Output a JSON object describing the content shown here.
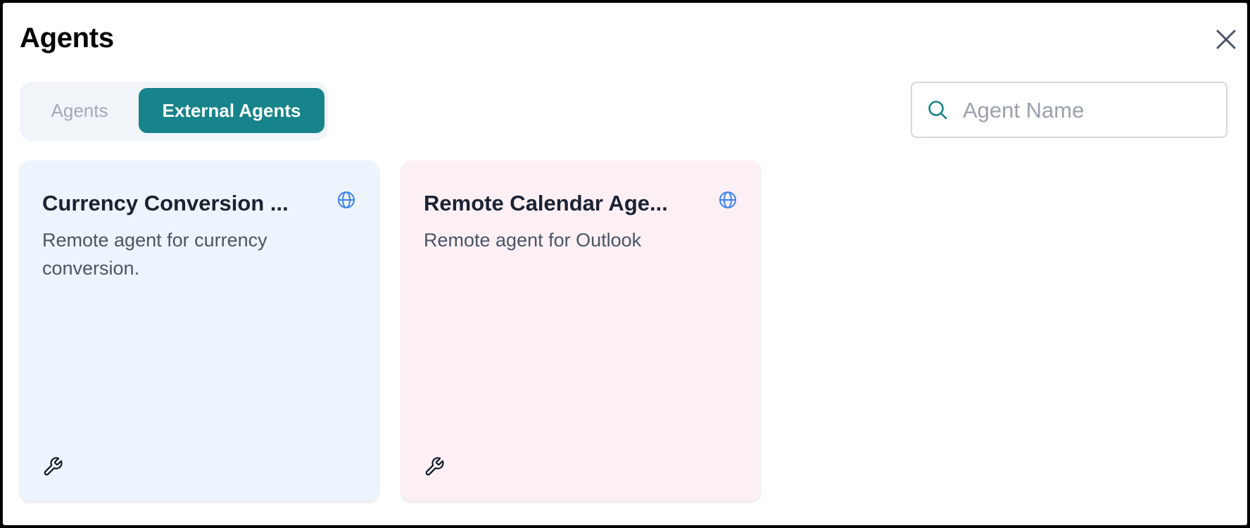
{
  "dialog": {
    "title": "Agents",
    "close_icon": "close-icon"
  },
  "tabs": [
    {
      "label": "Agents",
      "active": false
    },
    {
      "label": "External Agents",
      "active": true
    }
  ],
  "search": {
    "placeholder": "Agent Name",
    "value": "",
    "icon": "search-icon"
  },
  "cards": [
    {
      "title": "Currency Conversion ...",
      "description": "Remote agent for currency conversion.",
      "badge_icon": "globe-icon",
      "tool_icon": "wrench-icon",
      "background": "#edf4fd"
    },
    {
      "title": "Remote Calendar Age...",
      "description": "Remote agent for Outlook",
      "badge_icon": "globe-icon",
      "tool_icon": "wrench-icon",
      "background": "#fcf0f5"
    }
  ],
  "colors": {
    "accent": "#17838a",
    "globe": "#3b82f6",
    "title_text": "#1a2233",
    "body_text": "#4a5565"
  }
}
